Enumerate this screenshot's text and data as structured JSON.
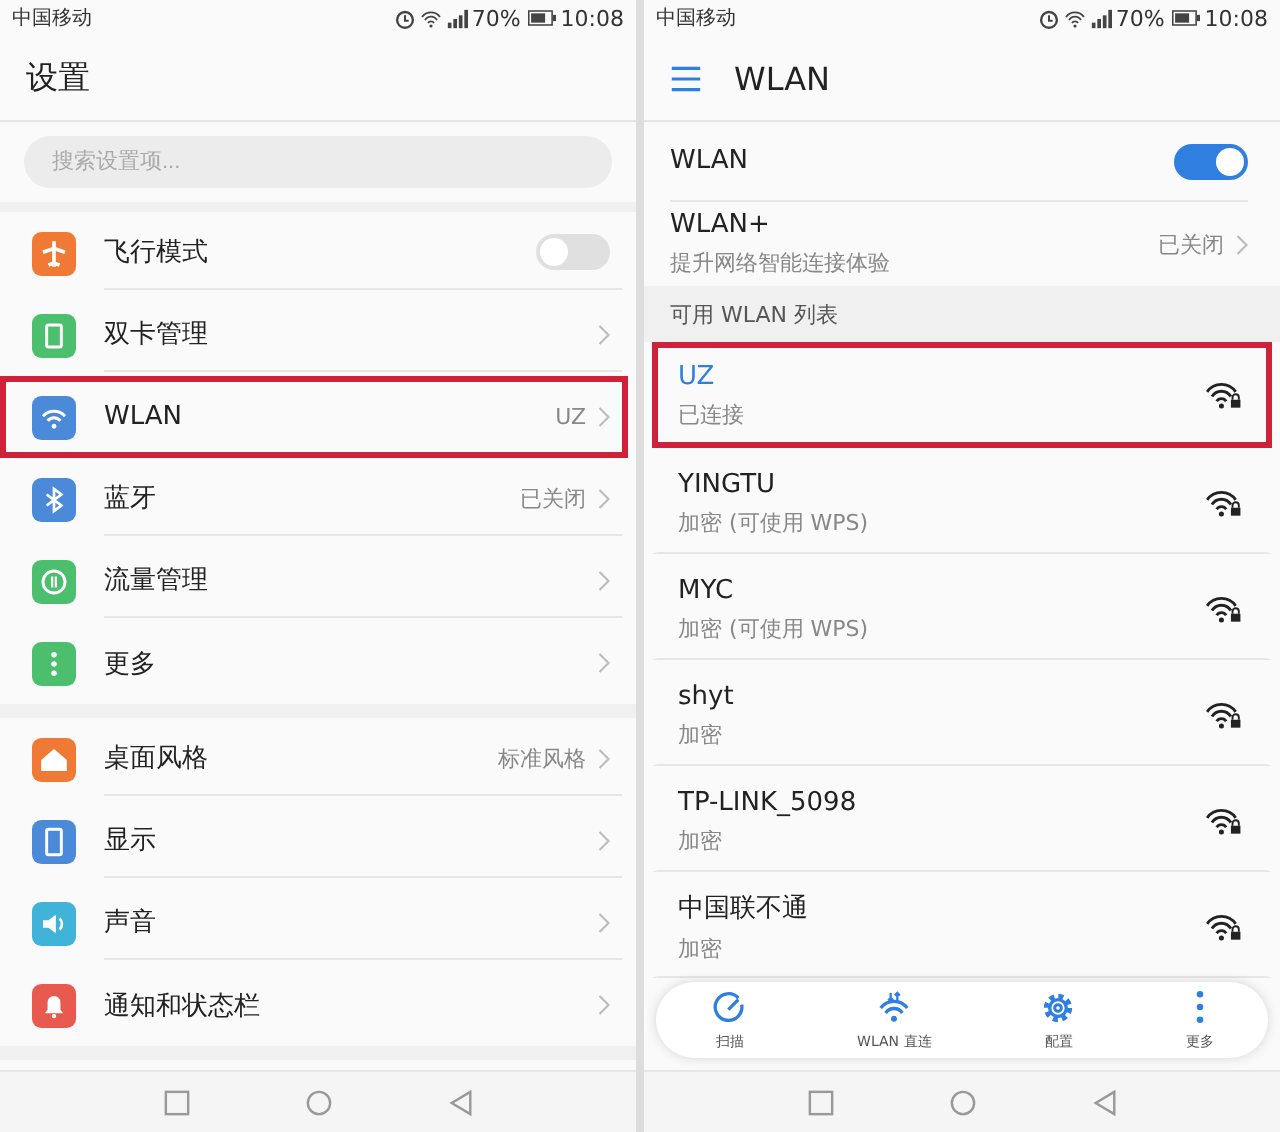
{
  "screens": [
    {
      "status_bar": {
        "carrier": "中国移动",
        "battery": "70%",
        "time": "10:08"
      },
      "header": {
        "title": "设置"
      },
      "search": {
        "placeholder": "搜索设置项..."
      },
      "groups": [
        {
          "items": [
            {
              "label": "飞行模式",
              "kind": "toggle",
              "on": false,
              "color": "#f07a35",
              "highlighted": false
            },
            {
              "label": "双卡管理",
              "kind": "link",
              "color": "#4cbf6e",
              "highlighted": false
            },
            {
              "label": "WLAN",
              "kind": "link",
              "value": "UZ",
              "color": "#4a8ad8",
              "highlighted": true
            },
            {
              "label": "蓝牙",
              "kind": "link",
              "value": "已关闭",
              "color": "#4a8ad8",
              "highlighted": false
            },
            {
              "label": "流量管理",
              "kind": "link",
              "color": "#4cbf6e",
              "highlighted": false
            },
            {
              "label": "更多",
              "kind": "link",
              "color": "#4cbf6e",
              "highlighted": false
            }
          ]
        },
        {
          "items": [
            {
              "label": "桌面风格",
              "kind": "link",
              "value": "标准风格",
              "color": "#f07a35",
              "highlighted": false
            },
            {
              "label": "显示",
              "kind": "link",
              "color": "#4a8ad8",
              "highlighted": false
            },
            {
              "label": "声音",
              "kind": "link",
              "color": "#3fb3d8",
              "highlighted": false
            },
            {
              "label": "通知和状态栏",
              "kind": "link",
              "color": "#e85a4f",
              "highlighted": false
            }
          ]
        }
      ]
    },
    {
      "status_bar": {
        "carrier": "中国移动",
        "battery": "70%",
        "time": "10:08"
      },
      "header": {
        "title": "WLAN"
      },
      "settings": [
        {
          "label": "WLAN",
          "kind": "toggle",
          "on": true
        },
        {
          "label": "WLAN+",
          "kind": "link",
          "subtitle": "提升网络智能连接体验",
          "value": "已关闭"
        }
      ],
      "section": {
        "title": "可用 WLAN 列表"
      },
      "networks": [
        {
          "name": "UZ",
          "status": "已连接",
          "connected": true,
          "highlighted": true
        },
        {
          "name": "YINGTU",
          "status": "加密 (可使用 WPS)",
          "connected": false,
          "highlighted": false
        },
        {
          "name": "MYC",
          "status": "加密 (可使用 WPS)",
          "connected": false,
          "highlighted": false
        },
        {
          "name": "shyt",
          "status": "加密",
          "connected": false,
          "highlighted": false
        },
        {
          "name": "TP-LINK_5098",
          "status": "加密",
          "connected": false,
          "highlighted": false
        },
        {
          "name": "中国联不通",
          "status": "加密",
          "connected": false,
          "highlighted": false
        }
      ],
      "toolbar": [
        {
          "label": "扫描",
          "kind": "scan"
        },
        {
          "label": "WLAN 直连",
          "kind": "direct"
        },
        {
          "label": "配置",
          "kind": "config"
        },
        {
          "label": "更多",
          "kind": "more"
        }
      ]
    }
  ]
}
